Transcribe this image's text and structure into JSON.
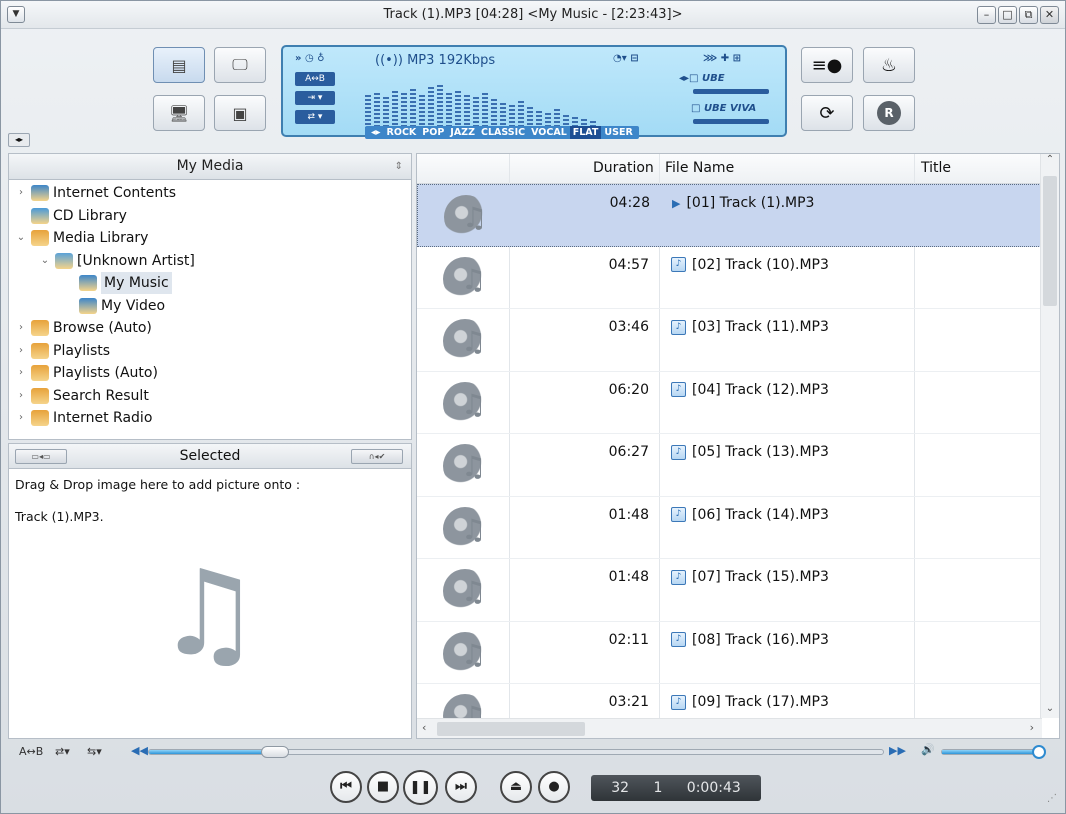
{
  "window": {
    "title": "Track (1).MP3   [04:28]    <My Music - [2:23:43]>"
  },
  "lcd": {
    "format": "MP3 192Kbps",
    "ab": "A↔B",
    "presets": [
      "ROCK",
      "POP",
      "JAZZ",
      "CLASSIC",
      "VOCAL",
      "FLAT",
      "USER"
    ],
    "selected_preset": "FLAT",
    "effects": [
      "UBE",
      "UBE VIVA"
    ]
  },
  "my_media": {
    "header": "My Media",
    "tree": [
      {
        "label": "Internet Contents",
        "level": 0
      },
      {
        "label": "CD Library",
        "level": 0
      },
      {
        "label": "Media Library",
        "level": 0
      },
      {
        "label": "[Unknown Artist]",
        "level": 1
      },
      {
        "label": "My Music",
        "level": 2,
        "selected": true
      },
      {
        "label": "My Video",
        "level": 2
      },
      {
        "label": "Browse (Auto)",
        "level": 0
      },
      {
        "label": "Playlists",
        "level": 0
      },
      {
        "label": "Playlists (Auto)",
        "level": 0
      },
      {
        "label": "Search Result",
        "level": 0
      },
      {
        "label": "Internet Radio",
        "level": 0
      }
    ]
  },
  "selected_panel": {
    "header": "Selected",
    "drag_text": "Drag & Drop image here to add picture onto :",
    "filename": "Track (1).MP3."
  },
  "grid": {
    "columns": [
      "Duration",
      "File Name",
      "Title"
    ],
    "rows": [
      {
        "duration": "04:28",
        "file": "[01] Track (1).MP3",
        "playing": true
      },
      {
        "duration": "04:57",
        "file": "[02] Track (10).MP3"
      },
      {
        "duration": "03:46",
        "file": "[03] Track (11).MP3"
      },
      {
        "duration": "06:20",
        "file": "[04] Track (12).MP3"
      },
      {
        "duration": "06:27",
        "file": "[05] Track (13).MP3"
      },
      {
        "duration": "01:48",
        "file": "[06] Track (14).MP3"
      },
      {
        "duration": "01:48",
        "file": "[07] Track (15).MP3"
      },
      {
        "duration": "02:11",
        "file": "[08] Track (16).MP3"
      },
      {
        "duration": "03:21",
        "file": "[09] Track (17).MP3"
      }
    ]
  },
  "playback": {
    "ab_label": "A↔B",
    "seek_progress": 0.16,
    "volume_level": 1.0,
    "counter_a": "32",
    "counter_b": "1",
    "time": "0:00:43"
  },
  "icons": {
    "prev": "prev-icon",
    "stop": "stop-icon",
    "pause": "pause-icon",
    "next": "next-icon",
    "open": "open-icon",
    "record": "record-icon"
  }
}
